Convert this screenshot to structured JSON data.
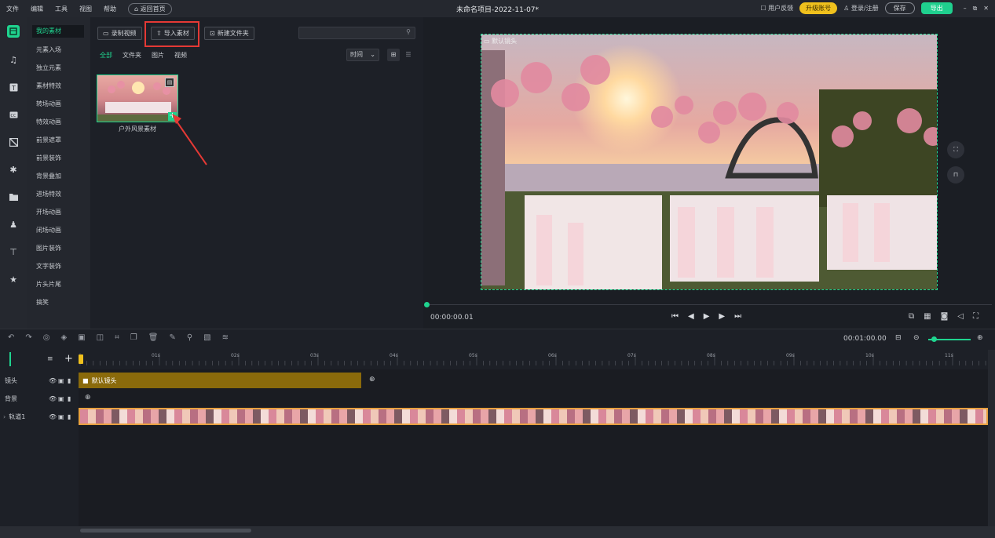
{
  "menu": [
    "文件",
    "编辑",
    "工具",
    "视图",
    "帮助"
  ],
  "back_home": "返回首页",
  "window_title": "未命名项目-2022-11-07*",
  "topright": {
    "feedback": "用户反馈",
    "upgrade": "升级账号",
    "login": "登录/注册",
    "save": "保存",
    "export": "导出"
  },
  "categories": [
    "我的素材",
    "元素入场",
    "独立元素",
    "素材特效",
    "转场动画",
    "特效动画",
    "前景遮罩",
    "前景装饰",
    "背景叠加",
    "进场特效",
    "开场动画",
    "闭场动画",
    "图片装饰",
    "文字装饰",
    "片头片尾",
    "搞笑"
  ],
  "media": {
    "record_btn": "录制视频",
    "import_btn": "导入素材",
    "newfolder_btn": "新建文件夹",
    "search_placeholder": "",
    "filters": [
      "全部",
      "文件夹",
      "图片",
      "视频"
    ],
    "sort": "时间",
    "thumb_label": "户外风景素材"
  },
  "preview": {
    "time": "00:00:00.01",
    "watermark": "默认镜头"
  },
  "timeline": {
    "duration": "00:01:00.00",
    "seconds": [
      "01s",
      "02s",
      "03s",
      "04s",
      "05s",
      "06s",
      "07s",
      "08s",
      "09s",
      "10s",
      "11s"
    ],
    "tracks": [
      {
        "name": "镜头"
      },
      {
        "name": "背景"
      },
      {
        "name": "轨道1"
      }
    ],
    "camera_clip": "默认镜头"
  },
  "colors": {
    "accent": "#1fd48f",
    "upgrade": "#f0c11d",
    "highlight": "#e53935",
    "clip_gold": "#8a6a0b",
    "track_orange": "#e8a040"
  }
}
